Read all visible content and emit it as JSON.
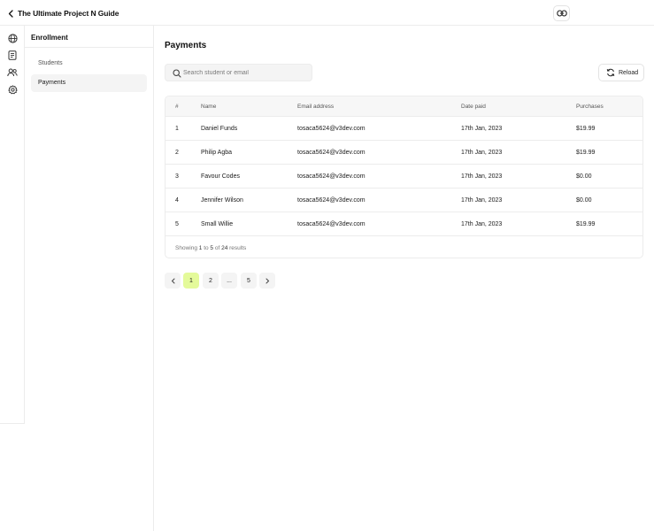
{
  "header": {
    "title": "The Ultimate Project N Guide",
    "back_icon": "chevron-left-icon",
    "link_icon": "link-icon"
  },
  "rail": {
    "icons": [
      "globe-icon",
      "document-icon",
      "users-icon",
      "gear-icon"
    ]
  },
  "subnav": {
    "title": "Enrollment",
    "items": [
      {
        "label": "Students",
        "active": false
      },
      {
        "label": "Payments",
        "active": true
      }
    ]
  },
  "main": {
    "title": "Payments",
    "search": {
      "placeholder": "Search student or email",
      "value": ""
    },
    "reload_label": "Reload"
  },
  "table": {
    "columns": [
      "#",
      "Name",
      "Email address",
      "Date paid",
      "Purchases"
    ],
    "rows": [
      {
        "num": "1",
        "name": "Daniel Funds",
        "email": "tosaca5624@v3dev.com",
        "date": "17th Jan, 2023",
        "purchases": "$19.99"
      },
      {
        "num": "2",
        "name": "Philip Agba",
        "email": "tosaca5624@v3dev.com",
        "date": "17th Jan, 2023",
        "purchases": "$19.99"
      },
      {
        "num": "3",
        "name": "Favour Codes",
        "email": "tosaca5624@v3dev.com",
        "date": "17th Jan, 2023",
        "purchases": "$0.00"
      },
      {
        "num": "4",
        "name": "Jennifer Wilson",
        "email": "tosaca5624@v3dev.com",
        "date": "17th Jan, 2023",
        "purchases": "$0.00"
      },
      {
        "num": "5",
        "name": "Small Willie",
        "email": "tosaca5624@v3dev.com",
        "date": "17th Jan, 2023",
        "purchases": "$19.99"
      }
    ],
    "footer": {
      "prefix": "Showing",
      "from": "1",
      "to_word": "to",
      "to": "5",
      "of_word": "of",
      "total": "24",
      "suffix": "results"
    }
  },
  "pagination": {
    "prev_icon": "chevron-left-icon",
    "pages": [
      "1",
      "2",
      "...",
      "5"
    ],
    "active_page": "1",
    "next_icon": "chevron-right-icon"
  },
  "colors": {
    "accent": "#e4fa9a"
  }
}
